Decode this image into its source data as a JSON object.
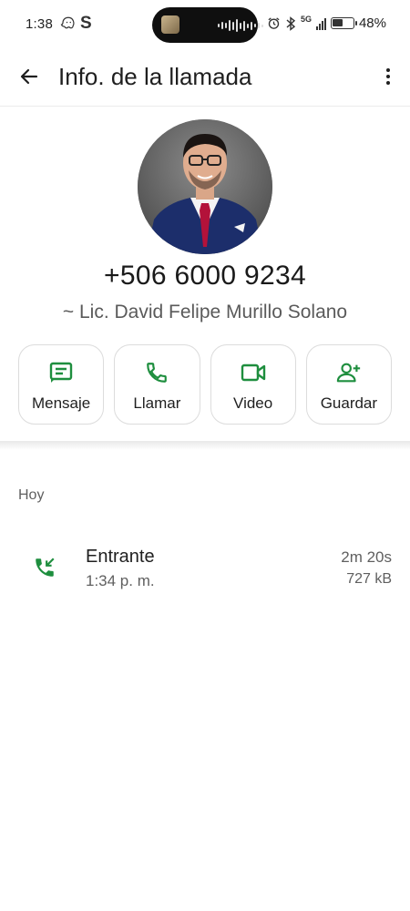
{
  "status_bar": {
    "time": "1:38",
    "carrier_glyph": "S",
    "network": "5G",
    "battery_percent": "48%",
    "battery_level": 0.48,
    "icons": [
      "waze-icon",
      "alarm-icon",
      "bluetooth-icon",
      "signal-icon",
      "battery-icon"
    ]
  },
  "app_bar": {
    "title": "Info. de la llamada",
    "back_icon": "arrow-back-icon",
    "menu_icon": "more-vert-icon"
  },
  "contact": {
    "phone_number": "+506 6000 9234",
    "name": "~ Lic. David Felipe Murillo Solano"
  },
  "actions": [
    {
      "label": "Mensaje",
      "icon": "message-icon"
    },
    {
      "label": "Llamar",
      "icon": "phone-icon"
    },
    {
      "label": "Video",
      "icon": "videocam-icon"
    },
    {
      "label": "Guardar",
      "icon": "person-add-icon"
    }
  ],
  "history": {
    "section_label": "Hoy",
    "calls": [
      {
        "type": "Entrante",
        "time": "1:34 p. m.",
        "duration": "2m 20s",
        "size": "727 kB",
        "icon": "incoming-call-icon"
      }
    ]
  },
  "colors": {
    "accent_green": "#1e8e3e",
    "text_primary": "#1f1f1f",
    "text_secondary": "#5f5f5f",
    "border": "#dcdcdc"
  }
}
